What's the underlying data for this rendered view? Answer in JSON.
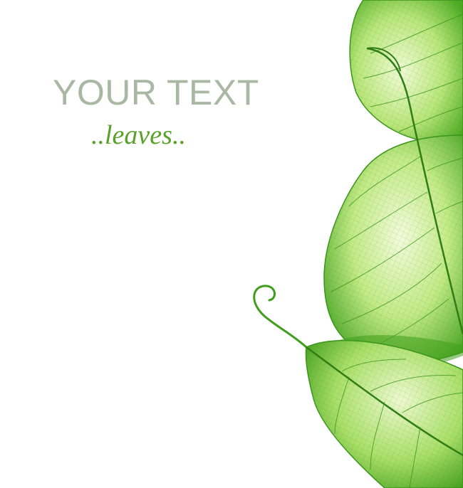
{
  "text": {
    "title": "YOUR TEXT",
    "subtitle": "..leaves.."
  },
  "colors": {
    "background": "#ffffff",
    "title": "#a9b8a2",
    "subtitle": "#5aa12a",
    "leaf_light": "#eaf8c9",
    "leaf_mid": "#9fdc5c",
    "leaf_dark": "#3f9f1c",
    "vein": "#2f7d14"
  }
}
